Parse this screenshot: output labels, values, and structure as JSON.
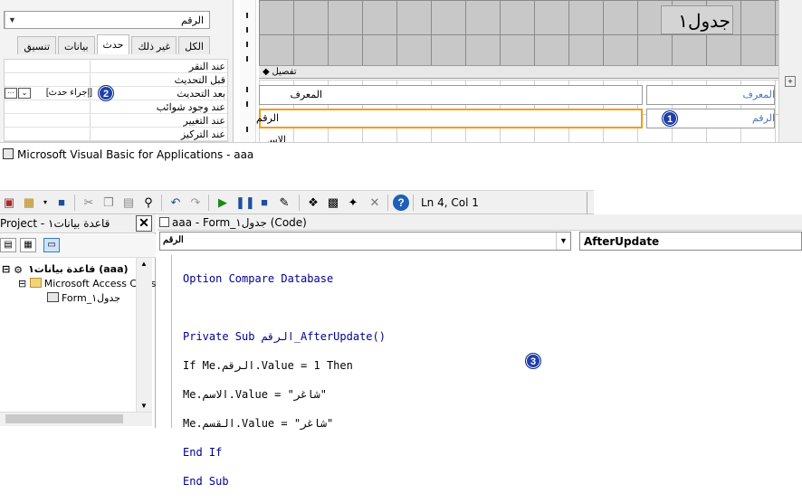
{
  "access": {
    "object_selector_value": "الرقم",
    "prop_tabs": [
      "الكل",
      "غير ذلك",
      "حدث",
      "بيانات",
      "تنسيق"
    ],
    "active_tab": "حدث",
    "event_rows": [
      "عند النقر",
      "قبل التحديث",
      "بعد التحديث",
      "عند وجود شوائب",
      "عند التغيير",
      "عند التركيز"
    ],
    "after_update_value": "[إجراء حدث]",
    "form_title": "جدول١",
    "section_label": "تفصيل",
    "field_labels": [
      "المعرف",
      "الرقم",
      "الاسم"
    ],
    "field_captions_right": [
      "المعرف",
      "الرقم"
    ]
  },
  "vba": {
    "window_title": "Microsoft Visual Basic for Applications - aaa",
    "cursor_position": "Ln 4, Col 1",
    "project_pane_title": "Project - قاعدة بيانات١",
    "tree": {
      "root": "قاعدة بيانات١ (aaa)",
      "folder": "Microsoft Access Class O",
      "form": "Form_جدول١"
    },
    "code_window_title": "aaa - Form_جدول١ (Code)",
    "object_combo": "الرقم",
    "procedure_combo": "AfterUpdate",
    "code_lines": [
      "Option Compare Database",
      "",
      "Private Sub الرقم_AfterUpdate()",
      "If Me.الرقم.Value = 1 Then",
      "Me.الاسم.Value = \"شاغر\"",
      "Me.القسم.Value = \"شاغر\"",
      "End If",
      "End Sub"
    ]
  },
  "annotations": [
    "1",
    "2",
    "3"
  ],
  "colors": {
    "highlight_border": "#f39c12",
    "badge": "#1e3fa8",
    "keyword": "#00008b"
  }
}
